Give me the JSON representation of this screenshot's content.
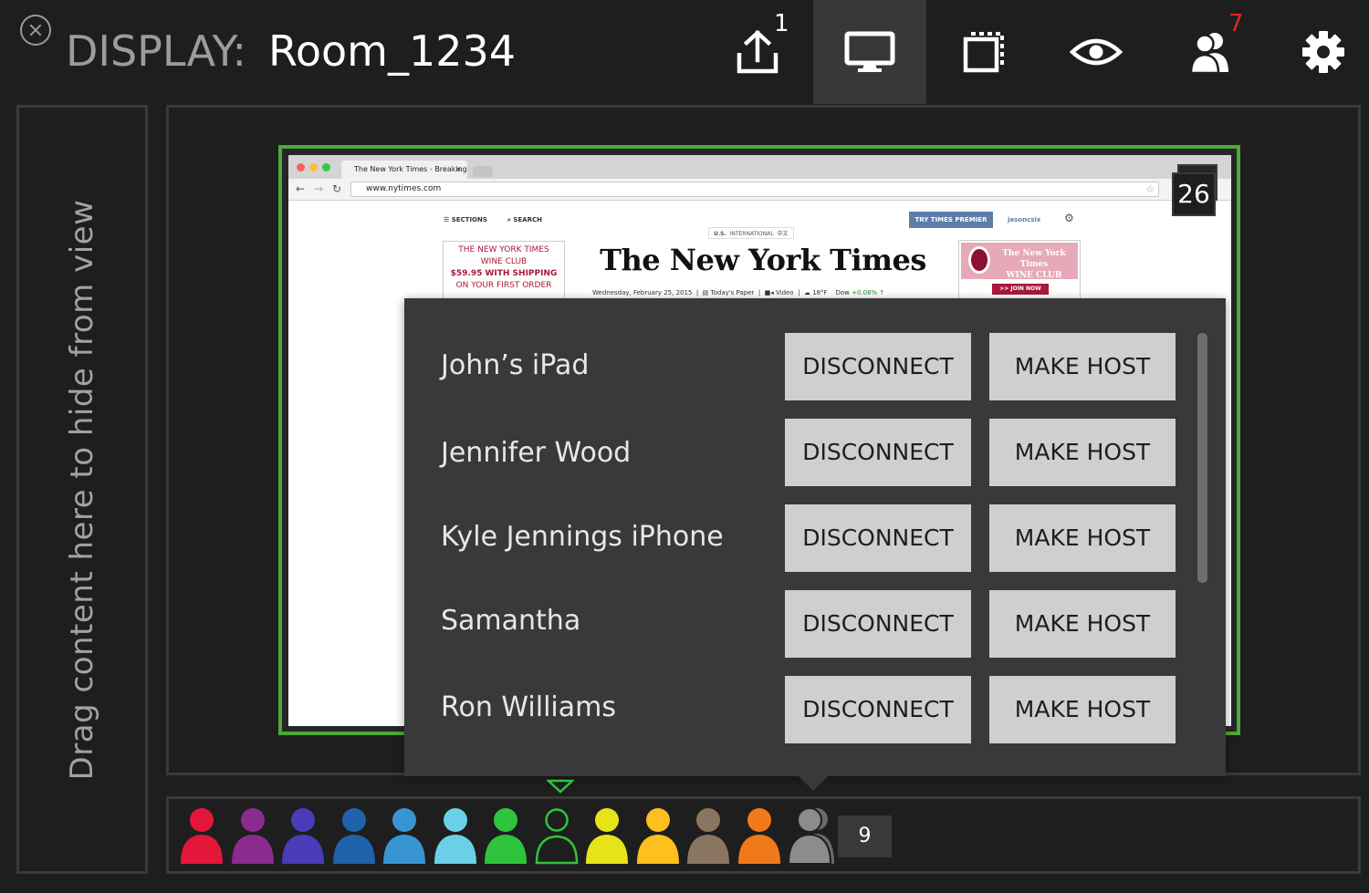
{
  "header": {
    "display_label": "DISPLAY:",
    "room_name": "Room_1234",
    "share_badge": "1",
    "participants_badge": "7"
  },
  "side_panel": {
    "hint": "Drag content here to hide from view"
  },
  "shared_content": {
    "browser": {
      "tab_title": "The New York Times - Breaking News",
      "tab_close": "×",
      "address": "www.nytimes.com",
      "star": "☆"
    },
    "page": {
      "sections": "SECTIONS",
      "search": "SEARCH",
      "premier_button": "TRY TIMES PREMIER",
      "user": "jasoncsix",
      "edition_us": "U.S.",
      "edition_international": "INTERNATIONAL",
      "edition_chinese": "中文",
      "wine_club_lines": [
        "THE NEW YORK TIMES",
        "WINE CLUB",
        "$59.95 WITH SHIPPING",
        "ON YOUR FIRST ORDER"
      ],
      "logo": "The New York Times",
      "date": "Wednesday, February 25, 2015",
      "todays_paper": "Today's Paper",
      "video": "Video",
      "temperature": "18°F",
      "dow_label": "Dow",
      "dow_change": "+0.08% ↑",
      "ad_title_1": "The New York Times",
      "ad_title_2": "WINE CLUB",
      "join_now": ">> JOIN NOW"
    },
    "content_count": "26"
  },
  "participants_menu": {
    "disconnect_label": "DISCONNECT",
    "make_host_label": "MAKE HOST",
    "participants": [
      {
        "name": "John’s iPad"
      },
      {
        "name": "Jennifer Wood"
      },
      {
        "name": "Kyle Jennings iPhone"
      },
      {
        "name": "Samantha"
      },
      {
        "name": "Ron Williams"
      }
    ]
  },
  "tray": {
    "avatar_colors": [
      "#e3173a",
      "#8b2a8f",
      "#4a3bb8",
      "#1f62aa",
      "#3895d1",
      "#6ccfe8",
      "#2ec43c",
      "outline",
      "#e6e31b",
      "#ffbf1f",
      "#8a7560",
      "#f07a1a",
      "#8c8c8c"
    ],
    "outline_color": "#2ec43c",
    "overflow_count": "9"
  },
  "colors": {
    "accent_green": "#4ea83a",
    "badge_red": "#e0242a",
    "icon_white": "#ffffff"
  }
}
